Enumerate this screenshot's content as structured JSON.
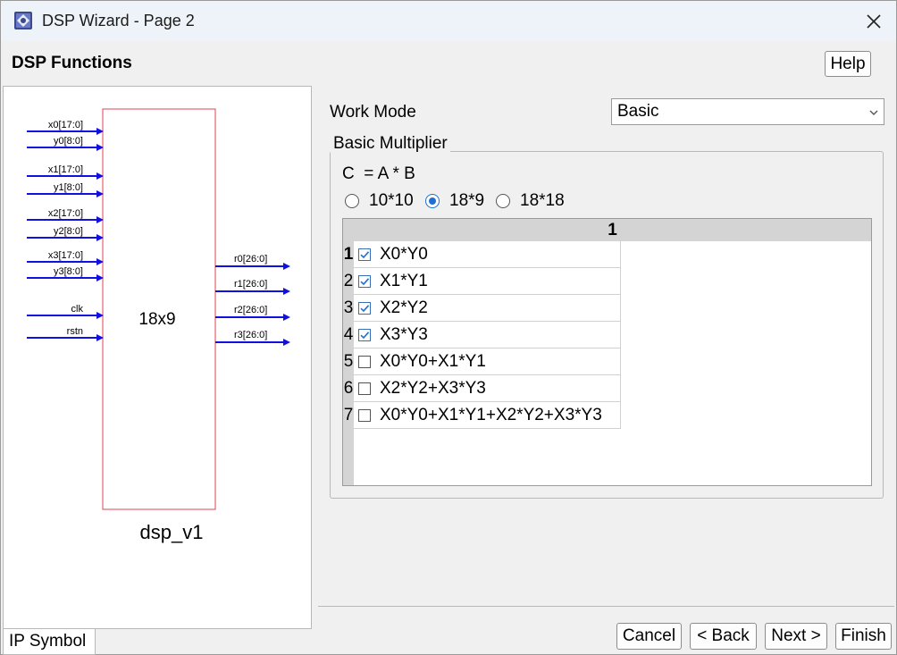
{
  "window": {
    "title": "DSP Wizard - Page 2"
  },
  "header": {
    "title": "DSP Functions",
    "help_label": "Help"
  },
  "symbol": {
    "block_label": "18x9",
    "instance_name": "dsp_v1",
    "inputs": [
      "x0[17:0]",
      "y0[8:0]",
      "x1[17:0]",
      "y1[8:0]",
      "x2[17:0]",
      "y2[8:0]",
      "x3[17:0]",
      "y3[8:0]",
      "clk",
      "rstn"
    ],
    "outputs": [
      "r0[26:0]",
      "r1[26:0]",
      "r2[26:0]",
      "r3[26:0]"
    ],
    "tab_label": "IP Symbol",
    "colors": {
      "block_border": "#e04050",
      "pin": "#1010e0"
    }
  },
  "work_mode": {
    "label": "Work Mode",
    "selected": "Basic"
  },
  "basic_multiplier": {
    "legend": "Basic Multiplier",
    "formula": "C  = A * B",
    "sizes": [
      {
        "label": "10*10",
        "checked": false
      },
      {
        "label": "18*9",
        "checked": true
      },
      {
        "label": "18*18",
        "checked": false
      }
    ],
    "table": {
      "column_header": "1",
      "rows": [
        {
          "num": "1",
          "label": "X0*Y0",
          "checked": true
        },
        {
          "num": "2",
          "label": "X1*Y1",
          "checked": true
        },
        {
          "num": "3",
          "label": "X2*Y2",
          "checked": true
        },
        {
          "num": "4",
          "label": "X3*Y3",
          "checked": true
        },
        {
          "num": "5",
          "label": "X0*Y0+X1*Y1",
          "checked": false
        },
        {
          "num": "6",
          "label": "X2*Y2+X3*Y3",
          "checked": false
        },
        {
          "num": "7",
          "label": "X0*Y0+X1*Y1+X2*Y2+X3*Y3",
          "checked": false
        }
      ]
    }
  },
  "footer": {
    "cancel": "Cancel",
    "back": "< Back",
    "next": "Next >",
    "finish": "Finish"
  },
  "accent_color": "#1f6fd1"
}
